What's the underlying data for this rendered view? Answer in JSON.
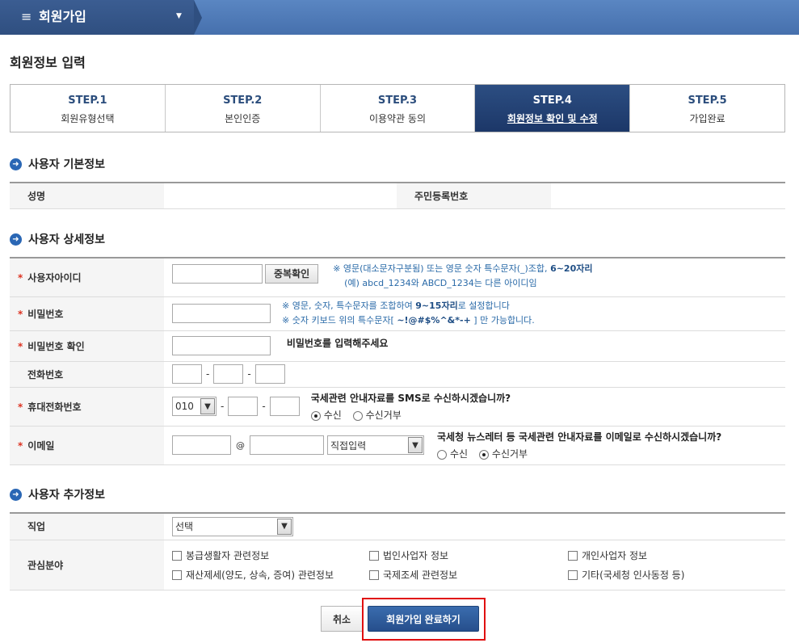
{
  "header": {
    "menu_icon": "≡",
    "title": "회원가입",
    "caret": "▼"
  },
  "page_title": "회원정보 입력",
  "steps": [
    {
      "num": "STEP.1",
      "label": "회원유형선택"
    },
    {
      "num": "STEP.2",
      "label": "본인인증"
    },
    {
      "num": "STEP.3",
      "label": "이용약관 동의"
    },
    {
      "num": "STEP.4",
      "label": "회원정보 확인 및 수정"
    },
    {
      "num": "STEP.5",
      "label": "가입완료"
    }
  ],
  "basic": {
    "title": "사용자 기본정보",
    "name_label": "성명",
    "rrn_label": "주민등록번호"
  },
  "detail": {
    "title": "사용자 상세정보",
    "req_mark": "*",
    "userid": {
      "label": "사용자아이디",
      "dup_btn": "중복확인",
      "hint1_pre": "※ 영문(대소문자구분됨) 또는 영문 숫자 특수문자(_)조합, ",
      "hint1_bold": "6~20자리",
      "hint2": "(예) abcd_1234와  ABCD_1234는 다른 아이디임"
    },
    "password": {
      "label": "비밀번호",
      "hint1_pre": "※ 영문, 숫자, 특수문자를 조합하여 ",
      "hint1_bold": "9~15자리",
      "hint1_post": "로 설정합니다",
      "hint2_pre": "※ 숫자 키보드 위의 특수문자[ ",
      "hint2_bold": "~!@#$%^&*-+",
      "hint2_post": " ] 만 가능합니다."
    },
    "password_confirm": {
      "label": "비밀번호 확인",
      "msg": "비밀번호를 입력해주세요"
    },
    "phone": {
      "label": "전화번호",
      "sep": "-"
    },
    "mobile": {
      "label": "휴대전화번호",
      "prefix": "010",
      "sep": "-",
      "question": "국세관련 안내자료를 SMS로 수신하시겠습니까?",
      "opt_yes": "수신",
      "opt_no": "수신거부"
    },
    "email": {
      "label": "이메일",
      "at": "@",
      "domain_select": "직접입력",
      "question": "국세청 뉴스레터 등 국세관련 안내자료를 이메일로 수신하시겠습니까?",
      "opt_yes": "수신",
      "opt_no": "수신거부"
    }
  },
  "extra": {
    "title": "사용자 추가정보",
    "job_label": "직업",
    "job_select": "선택",
    "interest_label": "관심분야",
    "interests": [
      "봉급생활자 관련정보",
      "법인사업자 정보",
      "개인사업자 정보",
      "재산제세(양도, 상속, 증여) 관련정보",
      "국제조세 관련정보",
      "기타(국세청 인사동정 등)"
    ]
  },
  "buttons": {
    "cancel": "취소",
    "complete": "회원가입 완료하기"
  },
  "colors": {
    "accent": "#2c4e82",
    "highlight": "#e01010",
    "hint": "#2a6aa8"
  }
}
